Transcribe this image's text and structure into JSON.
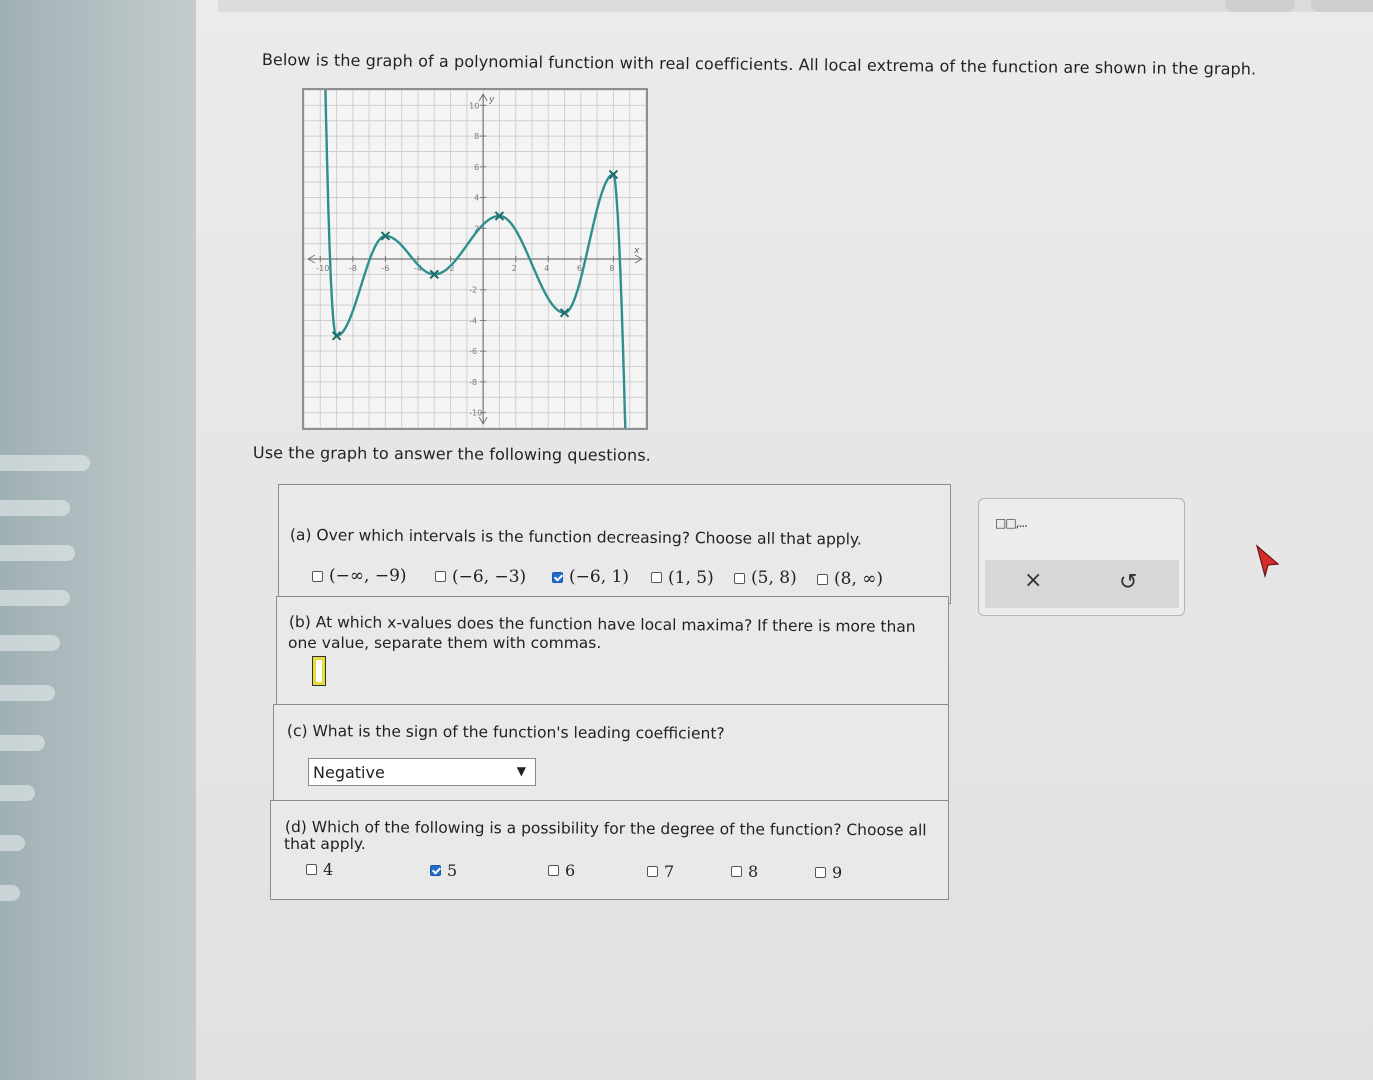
{
  "intro": "Below is the graph of a polynomial function with real coefficients. All local extrema of the function are shown in the graph.",
  "instruction": "Use the graph to answer the following questions.",
  "graph": {
    "x_label": "x",
    "y_label": "y",
    "x_ticks": [
      "-10",
      "-8",
      "-6",
      "-4",
      "-2",
      "2",
      "4",
      "6",
      "8"
    ],
    "y_ticks": [
      "10",
      "8",
      "6",
      "4",
      "2",
      "-2",
      "-4",
      "-6",
      "-8",
      "-10"
    ],
    "xlim": [
      -11,
      10
    ],
    "ylim": [
      -11,
      11
    ],
    "curve_color": "#2f8f8f",
    "extrema": [
      {
        "x": -9,
        "y": -5
      },
      {
        "x": -6,
        "y": 1.5
      },
      {
        "x": -3,
        "y": -1
      },
      {
        "x": 1,
        "y": 2.8
      },
      {
        "x": 5,
        "y": -3.5
      },
      {
        "x": 8,
        "y": 5.5
      }
    ]
  },
  "part_a": {
    "question": "(a) Over which intervals is the function decreasing? Choose all that apply.",
    "options": [
      {
        "label": "(−∞, −9)",
        "checked": false
      },
      {
        "label": "(−6, −3)",
        "checked": false
      },
      {
        "label": "(−6, 1)",
        "checked": true
      },
      {
        "label": "(1, 5)",
        "checked": false
      },
      {
        "label": "(5, 8)",
        "checked": false
      },
      {
        "label": "(8, ∞)",
        "checked": false
      }
    ]
  },
  "part_b": {
    "question_line1": "(b) At which x-values does the function have local maxima? If there is more than",
    "question_line2": "one value, separate them with commas.",
    "answer": ""
  },
  "part_c": {
    "question": "(c) What is the sign of the function's leading coefficient?",
    "selected": "Negative"
  },
  "part_d": {
    "question_line1": "(d) Which of the following is a possibility for the degree of the function? Choose all",
    "question_line2": "that apply.",
    "options": [
      {
        "label": "4",
        "checked": false
      },
      {
        "label": "5",
        "checked": true
      },
      {
        "label": "6",
        "checked": false
      },
      {
        "label": "7",
        "checked": false
      },
      {
        "label": "8",
        "checked": false
      },
      {
        "label": "9",
        "checked": false
      }
    ]
  },
  "tools": {
    "palette_icon": "□□,...",
    "clear_icon": "×",
    "undo_icon": "↺"
  }
}
